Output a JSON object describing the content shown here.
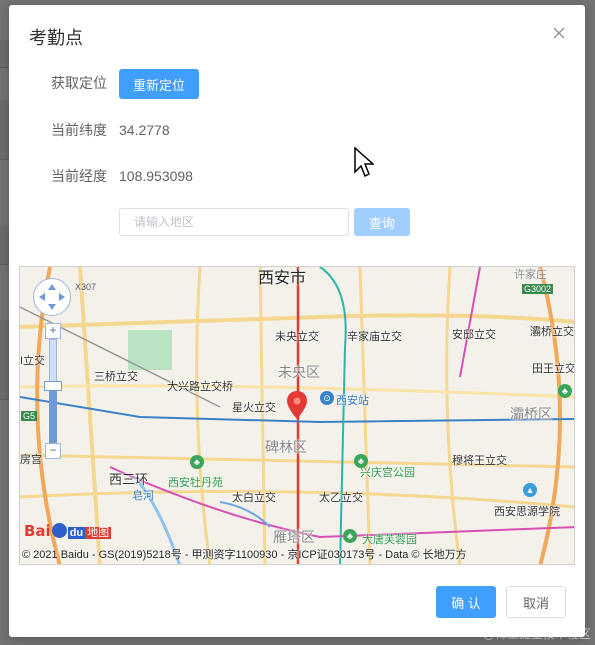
{
  "dialog": {
    "title": "考勤点",
    "fields": {
      "get_location_label": "获取定位",
      "relocate_button": "重新定位",
      "latitude_label": "当前纬度",
      "latitude_value": "34.2778",
      "longitude_label": "当前经度",
      "longitude_value": "108.953098"
    },
    "search": {
      "placeholder": "请输入地区",
      "button": "查询"
    },
    "footer": {
      "confirm": "确 认",
      "cancel": "取消"
    }
  },
  "map": {
    "city_label": "西安市",
    "labels": {
      "weiyang_interchange": "未央立交",
      "xinjia_interchange": "辛家庙立交",
      "anqiu_interchange": "安邸立交",
      "bahe_interchange": "灞桥立交",
      "tianwang": "田王立交",
      "sanqiao": "三桥立交",
      "daxing": "大兴路立交桥",
      "weiyang_district": "未央区",
      "xingzhuo": "星火立交",
      "xian_station": "西安站",
      "baqiao_district": "灞桥区",
      "beilin_district": "碑林区",
      "muta": "穆将王立交",
      "xingqing_park": "兴庆宫公园",
      "peony": "西安牡丹苑",
      "taibai": "太白立交",
      "taiyi": "太乙立交",
      "siyuan": "西安思源学院",
      "yanta_district": "雁塔区",
      "dayan": "大唐芙蓉园",
      "xisan": "西三环",
      "zao": "皂河",
      "xuyuan": "许家庄",
      "fangong": "房宫",
      "liqiao": "I立交",
      "g3002": "G3002",
      "x307": "X307",
      "g5": "G5"
    },
    "copyright": "© 2021 Baidu - GS(2019)5218号 - 甲测资字1100930 - 京ICP证030173号 - Data © 长地万方",
    "logo": {
      "bai": "Bai",
      "du": "du",
      "map": "地图"
    },
    "zoom_in": "+",
    "zoom_out": "−"
  },
  "watermark": "@稀土掘金技术社区",
  "colors": {
    "primary": "#409eff",
    "primary_disabled": "#a0cfff",
    "marker": "#e53935"
  },
  "icons": [
    "close-icon",
    "pan-control-icon",
    "location-marker-icon",
    "mouse-cursor-icon",
    "train-station-icon",
    "park-icon"
  ]
}
